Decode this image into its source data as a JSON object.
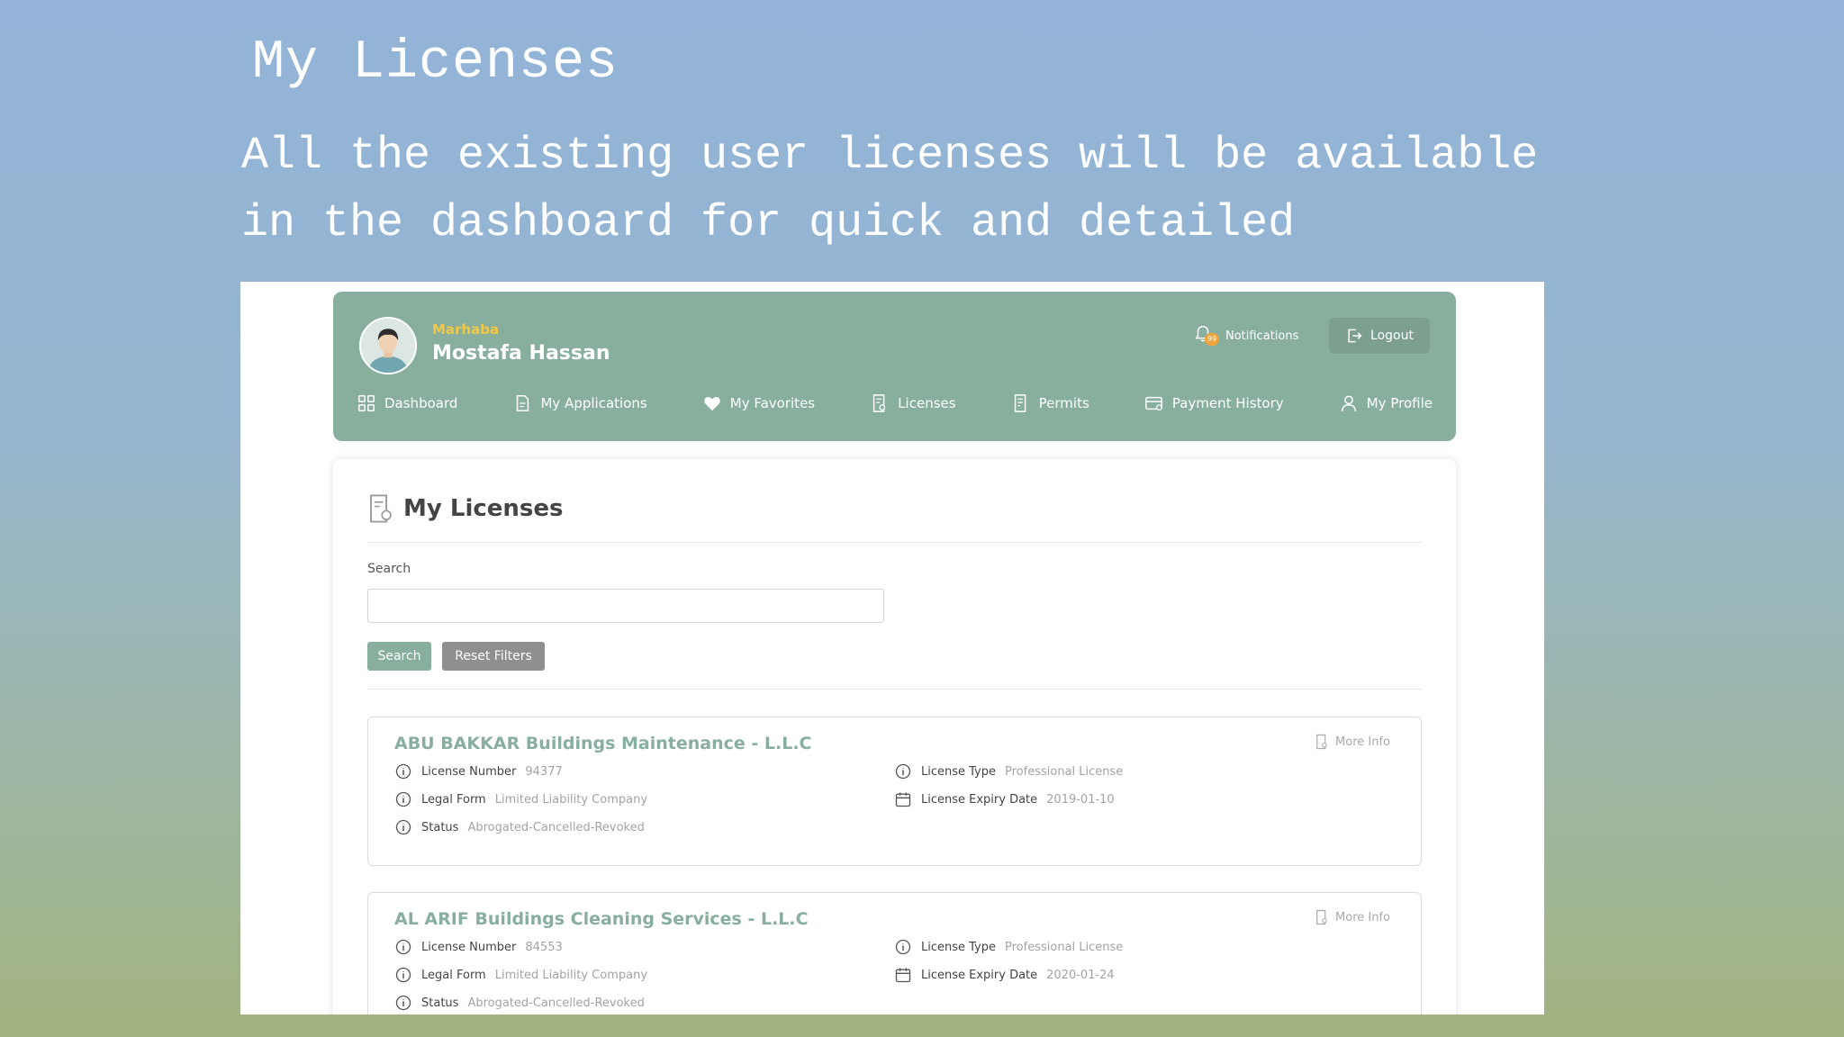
{
  "slide": {
    "title": "My Licenses",
    "description": "All the existing user licenses will be available in the dashboard for quick and detailed"
  },
  "header": {
    "greeting": "Marhaba",
    "user_name": "Mostafa Hassan",
    "notifications_label": "Notifications",
    "notifications_badge": "99",
    "logout_label": "Logout",
    "avatar_icon": "user-avatar"
  },
  "nav": {
    "items": [
      {
        "label": "Dashboard",
        "icon": "grid-icon"
      },
      {
        "label": "My Applications",
        "icon": "document-icon"
      },
      {
        "label": "My Favorites",
        "icon": "heart-icon"
      },
      {
        "label": "Licenses",
        "icon": "license-icon"
      },
      {
        "label": "Permits",
        "icon": "permit-icon"
      },
      {
        "label": "Payment History",
        "icon": "card-icon"
      },
      {
        "label": "My Profile",
        "icon": "person-icon"
      }
    ]
  },
  "main": {
    "title": "My Licenses",
    "search_label": "Search",
    "search_value": "",
    "search_button": "Search",
    "reset_button": "Reset Filters"
  },
  "labels": {
    "license_number": "License Number",
    "legal_form": "Legal Form",
    "status": "Status",
    "license_type": "License Type",
    "license_expiry_date": "License Expiry Date",
    "more_info": "More Info"
  },
  "licenses": [
    {
      "name": "ABU BAKKAR Buildings Maintenance - L.L.C",
      "license_number": "94377",
      "legal_form": "Limited Liability Company",
      "status": "Abrogated-Cancelled-Revoked",
      "license_type": "Professional License",
      "expiry_date": "2019-01-10"
    },
    {
      "name": "AL ARIF Buildings Cleaning Services - L.L.C",
      "license_number": "84553",
      "legal_form": "Limited Liability Company",
      "status": "Abrogated-Cancelled-Revoked",
      "license_type": "Professional License",
      "expiry_date": "2020-01-24"
    }
  ],
  "colors": {
    "brand": "#88ae9e",
    "greeting": "#f4c842",
    "reset_button": "#8f8f8f"
  }
}
